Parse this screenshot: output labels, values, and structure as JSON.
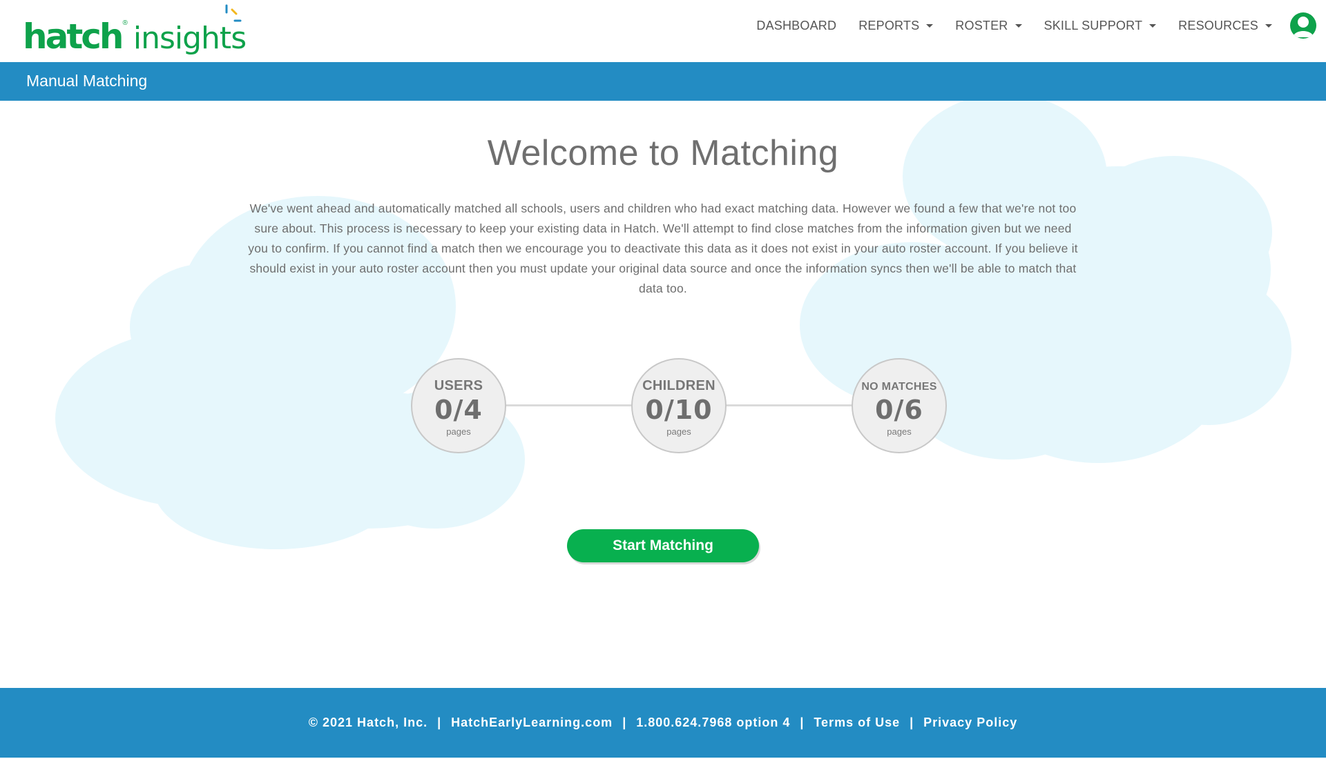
{
  "brand": {
    "name": "hatch",
    "registered_mark": "®",
    "product": "insights",
    "colors": {
      "green": "#0ea24b",
      "blue": "#238cc3",
      "button_green": "#08b04f",
      "cloud": "#e6f7fc"
    }
  },
  "nav": {
    "items": [
      {
        "label": "DASHBOARD",
        "has_dropdown": false
      },
      {
        "label": "REPORTS",
        "has_dropdown": true
      },
      {
        "label": "ROSTER",
        "has_dropdown": true
      },
      {
        "label": "SKILL SUPPORT",
        "has_dropdown": true
      },
      {
        "label": "RESOURCES",
        "has_dropdown": true
      }
    ],
    "avatar_icon": "user-avatar-icon"
  },
  "titlebar": {
    "title": "Manual Matching"
  },
  "main": {
    "heading": "Welcome to Matching",
    "intro": "We've went ahead and automatically matched all schools, users and children who had exact matching data. However we found a few that we're not too sure about. This process is necessary to keep your existing data in Hatch. We'll attempt to find close matches from the information given but we need you to confirm. If you cannot find a match then we encourage you to deactivate this data as it does not exist in your auto roster account. If you believe it should exist in your auto roster account then you must update your original data source and once the information syncs then we'll be able to match that data too.",
    "steps": [
      {
        "label": "USERS",
        "count": "0/4",
        "unit": "pages"
      },
      {
        "label": "CHILDREN",
        "count": "0/10",
        "unit": "pages"
      },
      {
        "label": "NO MATCHES",
        "count": "0/6",
        "unit": "pages"
      }
    ],
    "start_button": "Start Matching"
  },
  "footer": {
    "copyright": "© 2021 Hatch, Inc.",
    "website": "HatchEarlyLearning.com",
    "phone": "1.800.624.7968 option 4",
    "terms": "Terms of Use",
    "privacy": "Privacy Policy",
    "separator": "|"
  }
}
